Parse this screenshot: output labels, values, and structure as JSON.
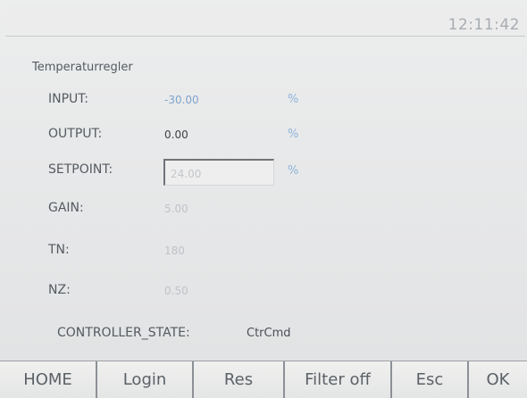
{
  "header": {
    "clock": "12:11:42"
  },
  "panel": {
    "title": "Temperaturregler",
    "rows": [
      {
        "label": "INPUT:",
        "value": "-30.00",
        "unit": "%"
      },
      {
        "label": "OUTPUT:",
        "value": "0.00",
        "unit": "%"
      },
      {
        "label": "SETPOINT:",
        "value": "24.00",
        "unit": "%"
      },
      {
        "label": "GAIN:",
        "value": "5.00"
      },
      {
        "label": "TN:",
        "value": "180"
      },
      {
        "label": "NZ:",
        "value": "0.50"
      }
    ],
    "controller_state": {
      "label": "CONTROLLER_STATE:",
      "value": "CtrCmd"
    }
  },
  "toolbar": {
    "buttons": [
      "HOME",
      "Login",
      "Res",
      "Filter off",
      "Esc",
      "OK"
    ]
  },
  "colors": {
    "background": "#e7e8ea",
    "value_blue": "#7fa4cc",
    "unit_blue": "#8fb4dc",
    "label_text": "#555a60"
  }
}
